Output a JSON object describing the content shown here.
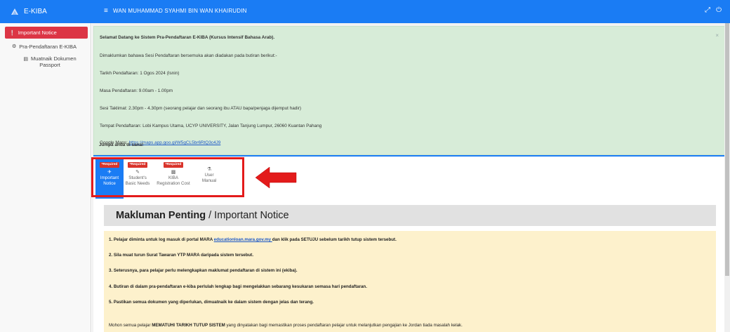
{
  "header": {
    "app_name": "E-KIBA",
    "menu_icon": "menu-icon",
    "user_name": "WAN MUHAMMAD SYAHMI BIN WAN KHAIRUDIN",
    "icons": [
      "expand-icon",
      "power-icon"
    ]
  },
  "sidebar": {
    "items": [
      {
        "label": "Important Notice",
        "icon": "info-icon",
        "active": true
      },
      {
        "label": "Pra-Pendaftaran E-KIBA",
        "icon": "user-gear-icon"
      },
      {
        "label_line1": "Muatnaik Dokumen",
        "label_line2": "Passport",
        "icon": "document-icon"
      }
    ]
  },
  "alert": {
    "line1": "Selamat Datang ke Sistem Pra-Pendaftaran E-KIBA (Kursus Intensif Bahasa Arab).",
    "line2": "Dimaklumkan bahawa Sesi Pendaftaran bersemuka akan diadakan pada butiran berikut:-",
    "line3": "Tarikh Pendaftaran: 1 Ogos 2024 (Isnin)",
    "line4": "Masa Pendaftaran: 9.00am - 1.00pm",
    "line5": "Sesi Taklimat: 2.30pm - 4.30pm (seorang pelajar dan seorang ibu ATAU bapa/penjaga dijemput hadir)",
    "line6": "Tempat Pendaftaran: Lobi Kampus Utama, UCYP UNIVERSITY, Jalan Tanjung Lumpur, 26060 Kuantan Pahang",
    "maps_label": "Google Maps: ",
    "maps_link": "https://maps.app.goo.gl/W5gCL5br6RtQ3c4J9",
    "line8": "Jumpa anda di sana!",
    "close": "×"
  },
  "tabs": [
    {
      "badge": "*Required",
      "icon": "plane-icon",
      "line1": "Important",
      "line2": "Notice",
      "active": true
    },
    {
      "badge": "*Required",
      "icon": "user-edit-icon",
      "line1": "Student's",
      "line2": "Basic Needs"
    },
    {
      "badge": "*Required",
      "icon": "file-icon",
      "line1": "KIBA",
      "line2": "Registration Cost"
    },
    {
      "badge": "",
      "icon": "manual-icon",
      "line1": "User",
      "line2": "Manual"
    }
  ],
  "section": {
    "title_bold": "Makluman Penting",
    "title_rest": "/ Important Notice"
  },
  "notice": {
    "item1_pre": "1. Pelajar diminta untuk log masuk di portal MARA ",
    "item1_link": "educationloan.mara.gov.my ",
    "item1_post": "dan klik pada SETUJU sebelum tarikh tutup sistem tersebut.",
    "item2": "2. Sila muat turun Surat Tawaran YTP MARA daripada sistem tersebut.",
    "item3": "3. Seterusnya, para pelajar perlu melengkapkan maklumat pendaftaran di sistem ini (ekiba).",
    "item4": "4. Butiran di dalam pra-pendaftaran e-kiba perlulah lengkap bagi mengelakkan sebarang kesukaran semasa hari pendaftaran.",
    "item5": "5. Pastikan semua dokumen yang diperlukan, dimuatnaik ke dalam sistem dengan jelas dan terang.",
    "closing_pre": "Mohon semua pelajar ",
    "closing_bold": "MEMATUHI TARIKH TUTUP SISTEM",
    "closing_post": " yang dinyatakan bagi memastikan proses pendaftaran pelajar untuk melanjutkan pengajian ke Jordan tiada masalah kelak."
  },
  "colors": {
    "primary": "#1a7cf4",
    "danger": "#dc3545",
    "alert_bg": "#d7ecd8",
    "notice_bg": "#fdf1cc",
    "highlight": "#e31b1b"
  }
}
